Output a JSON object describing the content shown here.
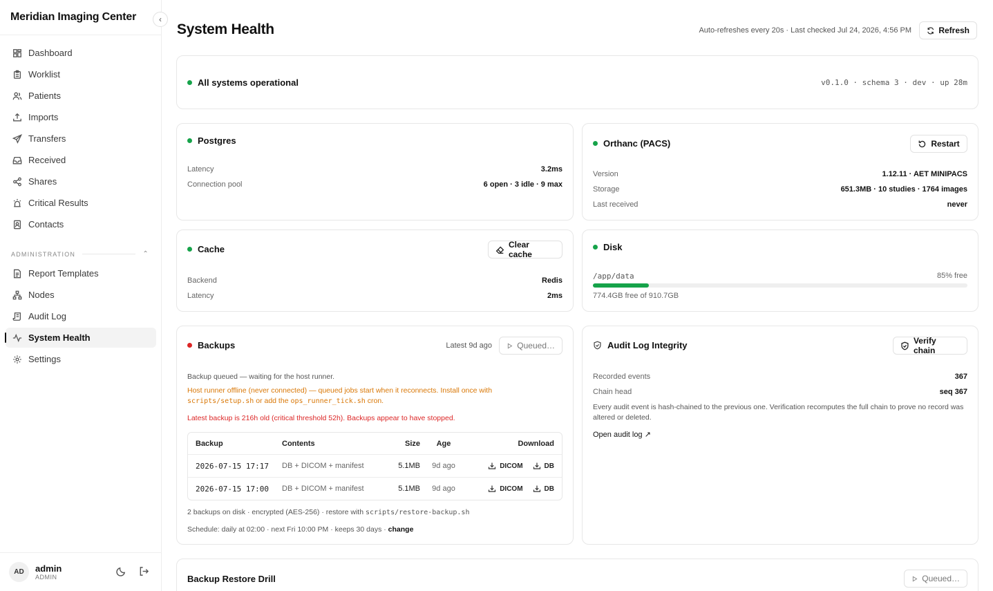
{
  "brand": "Meridian Imaging Center",
  "nav": {
    "items": [
      {
        "label": "Dashboard"
      },
      {
        "label": "Worklist"
      },
      {
        "label": "Patients"
      },
      {
        "label": "Imports"
      },
      {
        "label": "Transfers"
      },
      {
        "label": "Received"
      },
      {
        "label": "Shares"
      },
      {
        "label": "Critical Results"
      },
      {
        "label": "Contacts"
      }
    ],
    "admin_section": "ADMINISTRATION",
    "admin_items": [
      {
        "label": "Report Templates"
      },
      {
        "label": "Nodes"
      },
      {
        "label": "Audit Log"
      },
      {
        "label": "System Health"
      },
      {
        "label": "Settings"
      }
    ],
    "active": "System Health"
  },
  "user": {
    "initials": "AD",
    "name": "admin",
    "role": "ADMIN"
  },
  "header": {
    "title": "System Health",
    "refresh_meta": "Auto-refreshes every 20s · Last checked Jul 24, 2026, 4:56 PM",
    "refresh_label": "Refresh"
  },
  "status": {
    "label": "All systems operational",
    "meta": "v0.1.0 · schema 3 · dev · up 28m",
    "color": "#16a34a"
  },
  "postgres": {
    "title": "Postgres",
    "rows": [
      {
        "k": "Latency",
        "v": "3.2ms"
      },
      {
        "k": "Connection pool",
        "v": "6 open · 3 idle · 9 max"
      }
    ]
  },
  "orthanc": {
    "title": "Orthanc (PACS)",
    "action": "Restart",
    "rows": [
      {
        "k": "Version",
        "v": "1.12.11 · AET MINIPACS"
      },
      {
        "k": "Storage",
        "v": "651.3MB · 10 studies · 1764 images"
      },
      {
        "k": "Last received",
        "v": "never"
      }
    ]
  },
  "cache": {
    "title": "Cache",
    "action": "Clear cache",
    "rows": [
      {
        "k": "Backend",
        "v": "Redis"
      },
      {
        "k": "Latency",
        "v": "2ms"
      }
    ]
  },
  "disk": {
    "title": "Disk",
    "path": "/app/data",
    "free_label": "85% free",
    "used_fraction": 0.15,
    "detail": "774.4GB free of 910.7GB"
  },
  "backups": {
    "title": "Backups",
    "status_color": "#dc2626",
    "latest": "Latest 9d ago",
    "action": "Queued…",
    "queued_note": "Backup queued — waiting for the host runner.",
    "runner_note_a": "Host runner offline (never connected) — queued jobs start when it reconnects. Install once with",
    "runner_note_code1": "scripts/setup.sh",
    "runner_note_b": " or add the ",
    "runner_note_code2": "ops_runner_tick.sh",
    "runner_note_c": " cron.",
    "critical_note": "Latest backup is 216h old (critical threshold 52h). Backups appear to have stopped.",
    "columns": [
      "Backup",
      "Contents",
      "Size",
      "Age",
      "Download"
    ],
    "rows": [
      {
        "backup": "2026-07-15 17:17",
        "contents": "DB + DICOM + manifest",
        "size": "5.1MB",
        "age": "9d ago",
        "dl1": "DICOM",
        "dl2": "DB"
      },
      {
        "backup": "2026-07-15 17:00",
        "contents": "DB + DICOM + manifest",
        "size": "5.1MB",
        "age": "9d ago",
        "dl1": "DICOM",
        "dl2": "DB"
      }
    ],
    "footer_a": "2 backups on disk · encrypted (AES-256) · restore with ",
    "footer_code": "scripts/restore-backup.sh",
    "schedule_a": "Schedule: daily at 02:00 · next Fri 10:00 PM · keeps 30 days · ",
    "schedule_link": "change"
  },
  "audit": {
    "title": "Audit Log Integrity",
    "action": "Verify chain",
    "rows": [
      {
        "k": "Recorded events",
        "v": "367"
      },
      {
        "k": "Chain head",
        "v": "seq 367"
      }
    ],
    "description": "Every audit event is hash-chained to the previous one. Verification recomputes the full chain to prove no record was altered or deleted.",
    "link": "Open audit log ↗"
  },
  "drill": {
    "title": "Backup Restore Drill",
    "action": "Queued…"
  }
}
